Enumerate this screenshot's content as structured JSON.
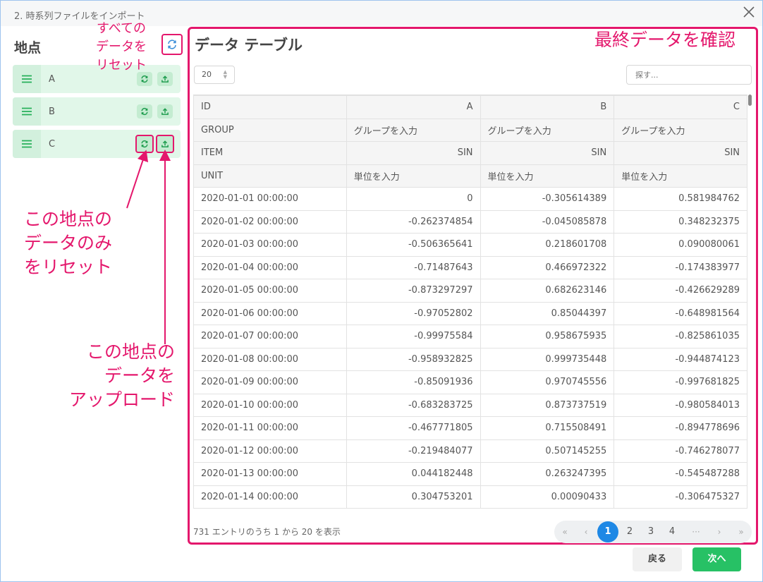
{
  "window": {
    "title": "2. 時系列ファイルをインポート"
  },
  "sidebar": {
    "title": "地点",
    "locations": [
      {
        "label": "A"
      },
      {
        "label": "B"
      },
      {
        "label": "C"
      }
    ]
  },
  "annotations": {
    "reset_all": [
      "すべての",
      "データを",
      "リセット"
    ],
    "final_check": "最終データを確認",
    "reset_one": [
      "この地点の",
      "データのみ",
      "をリセット"
    ],
    "upload_one": [
      "この地点の",
      "データを",
      "アップロード"
    ]
  },
  "panel": {
    "title": "データ テーブル",
    "page_size": "20",
    "search_placeholder": "探す...",
    "table": {
      "header": [
        "ID",
        "A",
        "B",
        "C"
      ],
      "meta_rows": [
        [
          "GROUP",
          "グループを入力",
          "グループを入力",
          "グループを入力"
        ],
        [
          "ITEM",
          "SIN",
          "SIN",
          "SIN"
        ],
        [
          "UNIT",
          "単位を入力",
          "単位を入力",
          "単位を入力"
        ]
      ],
      "rows": [
        [
          "2020-01-01 00:00:00",
          "0",
          "-0.305614389",
          "0.581984762"
        ],
        [
          "2020-01-02 00:00:00",
          "-0.262374854",
          "-0.045085878",
          "0.348232375"
        ],
        [
          "2020-01-03 00:00:00",
          "-0.506365641",
          "0.218601708",
          "0.090080061"
        ],
        [
          "2020-01-04 00:00:00",
          "-0.71487643",
          "0.466972322",
          "-0.174383977"
        ],
        [
          "2020-01-05 00:00:00",
          "-0.873297297",
          "0.682623146",
          "-0.426629289"
        ],
        [
          "2020-01-06 00:00:00",
          "-0.97052802",
          "0.85044397",
          "-0.648981564"
        ],
        [
          "2020-01-07 00:00:00",
          "-0.99975584",
          "0.958675935",
          "-0.825861035"
        ],
        [
          "2020-01-08 00:00:00",
          "-0.958932825",
          "0.999735448",
          "-0.944874123"
        ],
        [
          "2020-01-09 00:00:00",
          "-0.85091936",
          "0.970745556",
          "-0.997681825"
        ],
        [
          "2020-01-10 00:00:00",
          "-0.683283725",
          "0.873737519",
          "-0.980584013"
        ],
        [
          "2020-01-11 00:00:00",
          "-0.467771805",
          "0.715508491",
          "-0.894778696"
        ],
        [
          "2020-01-12 00:00:00",
          "-0.219484077",
          "0.507145255",
          "-0.746278077"
        ],
        [
          "2020-01-13 00:00:00",
          "0.044182448",
          "0.263247395",
          "-0.545487288"
        ],
        [
          "2020-01-14 00:00:00",
          "0.304753201",
          "0.00090433",
          "-0.306475327"
        ]
      ]
    },
    "footer_info": "731 エントリのうち 1 から 20 を表示",
    "pagination": {
      "first": "«",
      "prev": "‹",
      "pages": [
        "1",
        "2",
        "3",
        "4"
      ],
      "ellipsis": "···",
      "next": "›",
      "last": "»",
      "current": "1"
    }
  },
  "buttons": {
    "back": "戻る",
    "next": "次へ"
  },
  "colors": {
    "annotation": "#e4176c",
    "accent": "#1e88e5",
    "primary_green": "#27c165",
    "location_bg": "#e1f7e9"
  }
}
